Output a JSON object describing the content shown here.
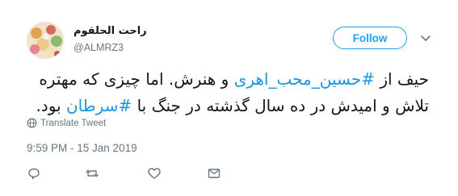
{
  "author": {
    "display_name": "راحت الحلقوم",
    "handle": "@ALMRZ3"
  },
  "follow_button": {
    "label": "Follow"
  },
  "tweet": {
    "line1_before": "حیف از ",
    "hashtag1": "#حسین_محب_اهری",
    "line1_after": " و هنرش. اما چیزی که مهتره",
    "line2_before": "تلاش و امیدش در ده سال گذشته در جنگ با ",
    "hashtag2": "#سرطان",
    "line2_after": " بود."
  },
  "translate": {
    "label": "Translate Tweet"
  },
  "timestamp": "9:59 PM - 15 Jan 2019",
  "icons": {
    "avatar": "avatar-photo",
    "menu": "chevron-down-icon",
    "translate": "globe-icon",
    "reply": "reply-icon",
    "retweet": "retweet-icon",
    "like": "heart-icon",
    "share": "envelope-icon"
  },
  "colors": {
    "accent": "#1da1f2",
    "hashtag": "#1b95e0",
    "muted": "#657786",
    "text": "#14171a"
  }
}
